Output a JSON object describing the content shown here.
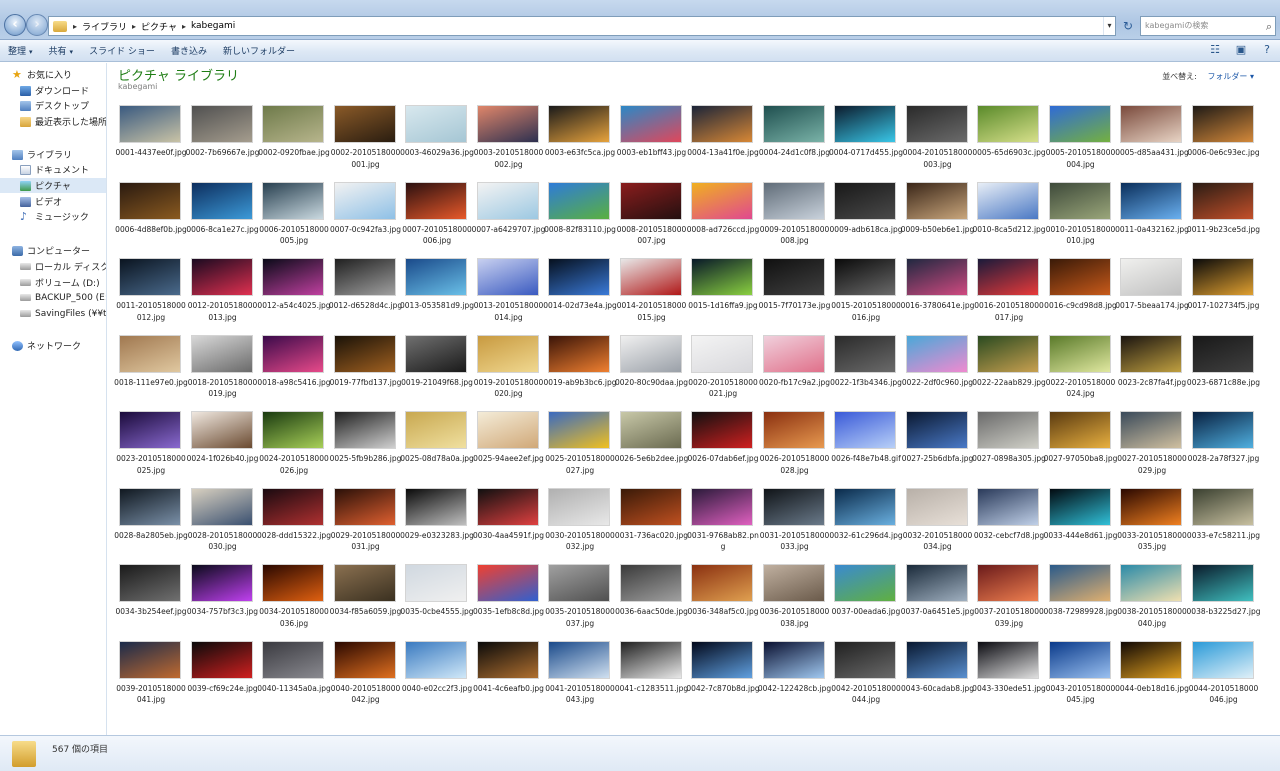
{
  "address": {
    "crumbs": [
      "ライブラリ",
      "ピクチャ",
      "kabegami"
    ],
    "search_placeholder": "kabegamiの検索"
  },
  "toolbar": {
    "organize": "整理",
    "share": "共有",
    "slideshow": "スライド ショー",
    "burn": "書き込み",
    "new_folder": "新しいフォルダー"
  },
  "nav": {
    "favorites": {
      "label": "お気に入り",
      "items": [
        "ダウンロード",
        "デスクトップ",
        "最近表示した場所"
      ]
    },
    "libraries": {
      "label": "ライブラリ",
      "items": [
        "ドキュメント",
        "ピクチャ",
        "ビデオ",
        "ミュージック"
      ]
    },
    "computer": {
      "label": "コンピューター",
      "items": [
        "ローカル ディスク (",
        "ボリューム (D:)",
        "BACKUP_500 (E:)",
        "SavingFiles (¥¥ter"
      ]
    },
    "network": {
      "label": "ネットワーク"
    }
  },
  "library": {
    "title": "ピクチャ ライブラリ",
    "subtitle": "kabegami",
    "arrange_label": "並べ替え:",
    "arrange_value": "フォルダー"
  },
  "status": {
    "count": "567 個の項目"
  },
  "files": [
    "0001-4437ee0f.jpg",
    "0002-7b69667e.jpg",
    "0002-0920fbae.jpg",
    "0002-2010518000001.jpg",
    "0003-46029a36.jpg",
    "0003-2010518000002.jpg",
    "0003-e63fc5ca.jpg",
    "0003-eb1bff43.jpg",
    "0004-13a41f0e.jpg",
    "0004-24d1c0f8.jpg",
    "0004-0717d455.jpg",
    "0004-2010518000003.jpg",
    "0005-65d6903c.jpg",
    "0005-2010518000004.jpg",
    "0005-d85aa431.jpg",
    "0006-0e6c93ec.jpg",
    "0006-4d88ef0b.jpg",
    "0006-8ca1e27c.jpg",
    "0006-2010518000005.jpg",
    "0007-0c942fa3.jpg",
    "0007-2010518000006.jpg",
    "0007-a6429707.jpg",
    "0008-82f83110.jpg",
    "0008-2010518000007.jpg",
    "0008-ad726ccd.jpg",
    "0009-2010518000008.jpg",
    "0009-adb618ca.jpg",
    "0009-b50eb6e1.jpg",
    "0010-8ca5d212.jpg",
    "0010-2010518000010.jpg",
    "0011-0a432162.jpg",
    "0011-9b23ce5d.jpg",
    "0011-2010518000012.jpg",
    "0012-2010518000013.jpg",
    "0012-a54c4025.jpg",
    "0012-d6528d4c.jpg",
    "0013-053581d9.jpg",
    "0013-2010518000014.jpg",
    "0014-02d73e4a.jpg",
    "0014-2010518000015.jpg",
    "0015-1d16ffa9.jpg",
    "0015-7f70173e.jpg",
    "0015-2010518000016.jpg",
    "0016-3780641e.jpg",
    "0016-2010518000017.jpg",
    "0016-c9cd98d8.jpg",
    "0017-5beaa174.jpg",
    "0017-102734f5.jpg",
    "0018-111e97e0.jpg",
    "0018-2010518000019.jpg",
    "0018-a98c5416.jpg",
    "0019-77fbd137.jpg",
    "0019-21049f68.jpg",
    "0019-2010518000020.jpg",
    "0019-ab9b3bc6.jpg",
    "0020-80c90daa.jpg",
    "0020-2010518000021.jpg",
    "0020-fb17c9a2.jpg",
    "0022-1f3b4346.jpg",
    "0022-2df0c960.jpg",
    "0022-22aab829.jpg",
    "0022-2010518000024.jpg",
    "0023-2c87fa4f.jpg",
    "0023-6871c88e.jpg",
    "0023-2010518000025.jpg",
    "0024-1f026b40.jpg",
    "0024-2010518000026.jpg",
    "0025-5fb9b286.jpg",
    "0025-08d78a0a.jpg",
    "0025-94aee2ef.jpg",
    "0025-2010518000027.jpg",
    "0026-5e6b2dee.jpg",
    "0026-07dab6ef.jpg",
    "0026-2010518000028.jpg",
    "0026-f48e7b48.gif",
    "0027-25b6dbfa.jpg",
    "0027-0898a305.jpg",
    "0027-97050ba8.jpg",
    "0027-2010518000029.jpg",
    "0028-2a78f327.jpg",
    "0028-8a2805eb.jpg",
    "0028-2010518000030.jpg",
    "0028-ddd15322.jpg",
    "0029-2010518000031.jpg",
    "0029-e0323283.jpg",
    "0030-4aa4591f.jpg",
    "0030-2010518000032.jpg",
    "0031-736ac020.jpg",
    "0031-9768ab82.png",
    "0031-2010518000033.jpg",
    "0032-61c296d4.jpg",
    "0032-2010518000034.jpg",
    "0032-cebcf7d8.jpg",
    "0033-444e8d61.jpg",
    "0033-2010518000035.jpg",
    "0033-e7c58211.jpg",
    "0034-3b254eef.jpg",
    "0034-757bf3c3.jpg",
    "0034-2010518000036.jpg",
    "0034-f85a6059.jpg",
    "0035-0cbe4555.jpg",
    "0035-1efb8c8d.jpg",
    "0035-2010518000037.jpg",
    "0036-6aac50de.jpg",
    "0036-348af5c0.jpg",
    "0036-2010518000038.jpg",
    "0037-00eada6.jpg",
    "0037-0a6451e5.jpg",
    "0037-2010518000039.jpg",
    "0038-72989928.jpg",
    "0038-2010518000040.jpg",
    "0038-b3225d27.jpg",
    "0039-2010518000041.jpg",
    "0039-cf69c24e.jpg",
    "0040-11345a0a.jpg",
    "0040-2010518000042.jpg",
    "0040-e02cc2f3.jpg",
    "0041-4c6eafb0.jpg",
    "0041-2010518000043.jpg",
    "0041-c1283511.jpg",
    "0042-7c870b8d.jpg",
    "0042-122428cb.jpg",
    "0042-2010518000044.jpg",
    "0043-60cadab8.jpg",
    "0043-330ede51.jpg",
    "0043-2010518000045.jpg",
    "0044-0eb18d16.jpg",
    "0044-2010518000046.jpg"
  ],
  "thumb_colors": [
    [
      "#3a5a80",
      "#c9c3a6"
    ],
    [
      "#505050",
      "#a59d8e"
    ],
    [
      "#6e7a4a",
      "#b7b58c"
    ],
    [
      "#8a5a28",
      "#2a1d10"
    ],
    [
      "#d8e8ee",
      "#a5c6d4"
    ],
    [
      "#e0866a",
      "#2d3050"
    ],
    [
      "#1a1a1a",
      "#e7a33d"
    ],
    [
      "#2b88c6",
      "#e0475b"
    ],
    [
      "#1b2438",
      "#d88836"
    ],
    [
      "#1f4f4f",
      "#7ab3a8"
    ],
    [
      "#0c1b2c",
      "#39c7e8"
    ],
    [
      "#2a2a2a",
      "#6b6b6b"
    ],
    [
      "#5a8a2a",
      "#d7e08b"
    ],
    [
      "#2f6bd6",
      "#74b040"
    ],
    [
      "#7a4a3c",
      "#e8d4c5"
    ],
    [
      "#1e1a16",
      "#d4893a"
    ],
    [
      "#2a1a10",
      "#8a5a20"
    ],
    [
      "#0d2e5e",
      "#3c9ad8"
    ],
    [
      "#284050",
      "#cad9e0"
    ],
    [
      "#f2f2f2",
      "#8ec0e6"
    ],
    [
      "#2b1010",
      "#e8592a"
    ],
    [
      "#f3f3f3",
      "#9cc8e2"
    ],
    [
      "#2e7bd8",
      "#5ab040"
    ],
    [
      "#8a1d1d",
      "#241010"
    ],
    [
      "#f0b020",
      "#e04890"
    ],
    [
      "#606c78",
      "#c9d2dc"
    ],
    [
      "#181818",
      "#4a4a4a"
    ],
    [
      "#3a2618",
      "#c9a67c"
    ],
    [
      "#e8eef6",
      "#4a78c4"
    ],
    [
      "#3e4a3a",
      "#9aa67a"
    ],
    [
      "#0a2e5a",
      "#6ab0f0"
    ],
    [
      "#2a1c14",
      "#c4502a"
    ],
    [
      "#0a1420",
      "#4a6a8c"
    ],
    [
      "#1a0a20",
      "#e03050"
    ],
    [
      "#0a0a18",
      "#c040a0"
    ],
    [
      "#202020",
      "#a0a0a0"
    ],
    [
      "#1a4a8a",
      "#6ac0e8"
    ],
    [
      "#c8d0f0",
      "#3a5ac0"
    ],
    [
      "#06101e",
      "#3a7ad8"
    ],
    [
      "#e8e8e8",
      "#b01818"
    ],
    [
      "#081828",
      "#8ad040"
    ],
    [
      "#101010",
      "#404040"
    ],
    [
      "#0a0a0a",
      "#6a6a6a"
    ],
    [
      "#202840",
      "#d04a80"
    ],
    [
      "#1a1a3a",
      "#e83a3a"
    ],
    [
      "#3a1a08",
      "#c85a1a"
    ],
    [
      "#f0f0ee",
      "#c0c0c0"
    ],
    [
      "#0a0a0a",
      "#e0a030"
    ],
    [
      "#a07850",
      "#e0c8a0"
    ],
    [
      "#d8d8d8",
      "#6a6a6a"
    ],
    [
      "#3a0a4a",
      "#e84a8a"
    ],
    [
      "#1a1208",
      "#a06020"
    ],
    [
      "#707070",
      "#1a1a1a"
    ],
    [
      "#c89a40",
      "#f0d890"
    ],
    [
      "#3a1408",
      "#f08030"
    ],
    [
      "#f0f0f0",
      "#9aa0a8"
    ],
    [
      "#f4f4f4",
      "#d8d8dc"
    ],
    [
      "#f0d0dc",
      "#e0708a"
    ],
    [
      "#2a2a2a",
      "#6a6a6a"
    ],
    [
      "#4aa8d8",
      "#f08ad0"
    ],
    [
      "#2a4a20",
      "#c8a050"
    ],
    [
      "#5a7a2a",
      "#e0e8a0"
    ],
    [
      "#1a1410",
      "#c0a040"
    ],
    [
      "#181818",
      "#404040"
    ],
    [
      "#1a0a3a",
      "#8a6ad0"
    ],
    [
      "#f0e8e0",
      "#6a4a30"
    ],
    [
      "#1a3a10",
      "#a8d058"
    ],
    [
      "#202020",
      "#d0d0d0"
    ],
    [
      "#c8a850",
      "#f0e0a0"
    ],
    [
      "#f4ecd8",
      "#d0a878"
    ],
    [
      "#3a6ac0",
      "#f0c020"
    ],
    [
      "#c8c8a8",
      "#6a6a50"
    ],
    [
      "#101010",
      "#d02020"
    ],
    [
      "#8a3010",
      "#e89a50"
    ],
    [
      "#3a5ad8",
      "#b8d0f8"
    ],
    [
      "#0a1830",
      "#4a7ac8"
    ],
    [
      "#6a6a6a",
      "#d0d0c8"
    ],
    [
      "#5a3a10",
      "#e8b040"
    ],
    [
      "#3a4a5a",
      "#d0c0a0"
    ],
    [
      "#082040",
      "#50b0e0"
    ],
    [
      "#101820",
      "#7a90a8"
    ],
    [
      "#d8d0c0",
      "#3a5070"
    ],
    [
      "#1a0a10",
      "#b03030"
    ],
    [
      "#2a1008",
      "#e06030"
    ],
    [
      "#0a0a0a",
      "#c0c0c0"
    ],
    [
      "#101010",
      "#e04040"
    ],
    [
      "#b0b0b0",
      "#e8e8e8"
    ],
    [
      "#3a1a08",
      "#c05020"
    ],
    [
      "#2a1a3a",
      "#e060c0"
    ],
    [
      "#101418",
      "#6a7a8a"
    ],
    [
      "#0a2a4a",
      "#6ab0e0"
    ],
    [
      "#b8b0a8",
      "#e8e0d8"
    ],
    [
      "#2a3a5a",
      "#c0d0e8"
    ],
    [
      "#020a10",
      "#30c0d8"
    ],
    [
      "#2a0800",
      "#f08020"
    ],
    [
      "#3a4030",
      "#c8c0a0"
    ],
    [
      "#1a1a1a",
      "#707070"
    ],
    [
      "#0a0a1a",
      "#c040f0"
    ],
    [
      "#2a0800",
      "#e06010"
    ],
    [
      "#8a7050",
      "#3a3020"
    ],
    [
      "#d0d8e0",
      "#f0f0f0"
    ],
    [
      "#f04030",
      "#3060d0"
    ],
    [
      "#a0a0a0",
      "#505050"
    ],
    [
      "#3a3a3a",
      "#a0a0a0"
    ],
    [
      "#8a3010",
      "#e0a050"
    ],
    [
      "#c0b0a0",
      "#6a5a4a"
    ],
    [
      "#3a8ad0",
      "#60b040"
    ],
    [
      "#1a2a3a",
      "#a0b0c0"
    ],
    [
      "#6a1a1a",
      "#f08050"
    ],
    [
      "#2a5a8a",
      "#e0b070"
    ],
    [
      "#2a8aa8",
      "#f0e0b0"
    ],
    [
      "#0a1a2a",
      "#40c0c0"
    ],
    [
      "#1a2a4a",
      "#c06a30"
    ],
    [
      "#0a0a0a",
      "#d02020"
    ],
    [
      "#3a3a40",
      "#8a8a90"
    ],
    [
      "#2a0800",
      "#e07020"
    ],
    [
      "#3a7ac0",
      "#d0e8f8"
    ],
    [
      "#0a0a0a",
      "#b07030"
    ],
    [
      "#1a4a8a",
      "#d0e0f0"
    ],
    [
      "#202020",
      "#e8e8e8"
    ],
    [
      "#02081a",
      "#60a0e0"
    ],
    [
      "#0a1030",
      "#a0c8f0"
    ],
    [
      "#202020",
      "#6a6a6a"
    ],
    [
      "#081830",
      "#5a90d0"
    ],
    [
      "#0a0a10",
      "#e0e0e0"
    ],
    [
      "#0a3a8a",
      "#9ac0f0"
    ],
    [
      "#100804",
      "#e0a020"
    ],
    [
      "#2a9ad8",
      "#e0f0f8"
    ],
    [
      "#c8d8e8",
      "#f8f8f8"
    ],
    [
      "#6a7a90",
      "#d0d8e0"
    ],
    [
      "#8a5a20",
      "#d0a050"
    ],
    [
      "#3a4a6a",
      "#e0d8c8"
    ],
    [
      "#c06a30",
      "#e8c8a0"
    ],
    [
      "#f0e8f0",
      "#d0a0c8"
    ],
    [
      "#0a0a10",
      "#8090a0"
    ],
    [
      "#0a2a3a",
      "#40a0c0"
    ],
    [
      "#a0c8e0",
      "#f0f8ff"
    ],
    [
      "#101010",
      "#6a8a6a"
    ],
    [
      "#2a6a10",
      "#90d060"
    ],
    [
      "#1a1a2a",
      "#6a7a8a"
    ],
    [
      "#0a1a2a",
      "#3a7a9a"
    ],
    [
      "#d0c0a0",
      "#f0e0c0"
    ],
    [
      "#8a1010",
      "#e04040"
    ],
    [
      "#0a1a2a",
      "#70a0b0"
    ]
  ]
}
